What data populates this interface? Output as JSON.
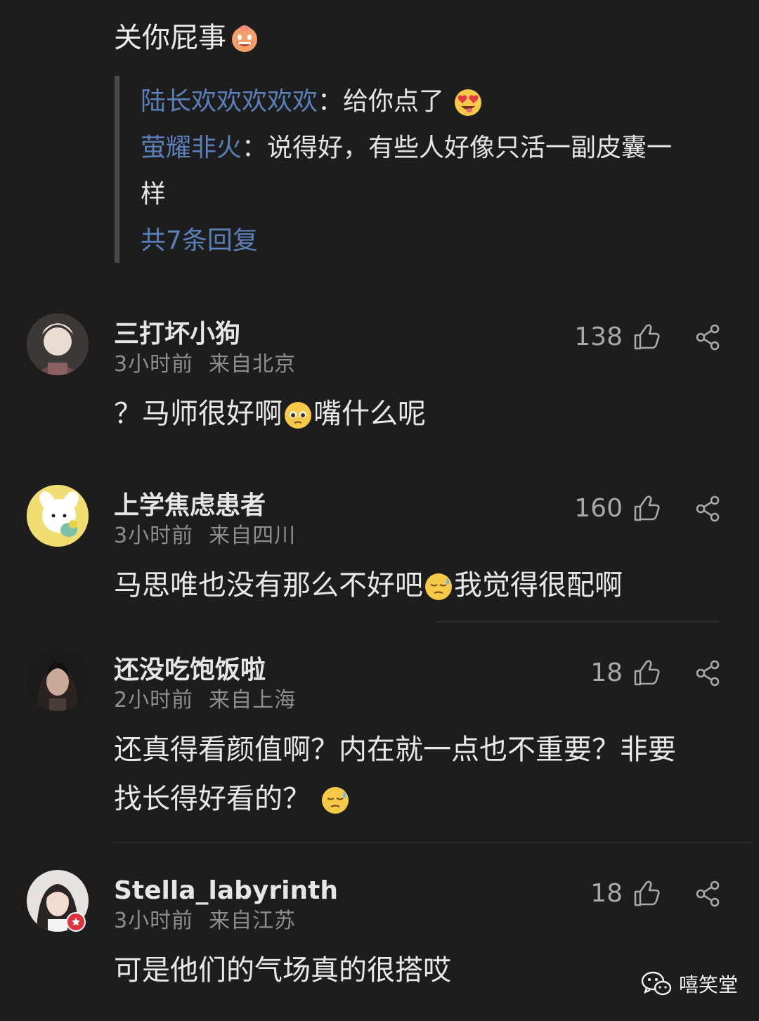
{
  "parent_comment": {
    "text": "关你屁事",
    "emoji": "grinning-face-emoji"
  },
  "replies_preview": [
    {
      "user": "陆长欢欢欢欢欢",
      "separator": "：",
      "text": "给你点了",
      "emoji": "heart-eyes-emoji"
    },
    {
      "user": "萤耀非火",
      "separator": "：",
      "text_line1": "说得好，有些人好像只活一副皮囊一",
      "text_line2": "样"
    }
  ],
  "more_replies_label": "共7条回复",
  "comments": [
    {
      "name": "三打坏小狗",
      "time": "3小时前",
      "location": "来自北京",
      "likes": "138",
      "text_before": "？马师很好啊",
      "emoji": "pleading-face-emoji",
      "text_after": "嘴什么呢"
    },
    {
      "name": "上学焦虑患者",
      "time": "3小时前",
      "location": "来自四川",
      "likes": "160",
      "text_before": "马思唯也没有那么不好吧",
      "emoji": "sweat-face-emoji",
      "text_after": "我觉得很配啊"
    },
    {
      "name": "还没吃饱饭啦",
      "time": "2小时前",
      "location": "来自上海",
      "likes": "18",
      "text_line1": "还真得看颜值啊？内在就一点也不重要？非要",
      "text_line2": "找长得好看的？",
      "emoji": "sweat-face-emoji"
    },
    {
      "name": "Stella_labyrinth",
      "time": "3小时前",
      "location": "来自江苏",
      "likes": "18",
      "text": "可是他们的气场真的很搭哎"
    }
  ],
  "watermark": {
    "icon": "wechat-icon",
    "label": "嘻笑堂"
  },
  "colors": {
    "background": "#1d1d1d",
    "username_link": "#5b7fb8",
    "meta": "#8e8e8e",
    "icon": "#a9a9a9"
  }
}
